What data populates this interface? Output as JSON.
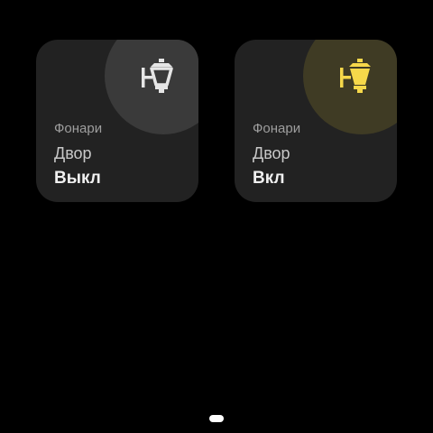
{
  "tiles": [
    {
      "category": "Фонари",
      "room": "Двор",
      "state": "Выкл",
      "icon": "street-lamp-icon",
      "icon_color": "#e6e6e6",
      "icon_bg_color": "#3a3a3a"
    },
    {
      "category": "Фонари",
      "room": "Двор",
      "state": "Вкл",
      "icon": "street-lamp-icon",
      "icon_color": "#f6d84a",
      "icon_bg_color": "#3f3b24"
    }
  ],
  "colors": {
    "background": "#000000",
    "tile": "#222222",
    "on_accent": "#f6d84a",
    "off_accent": "#e6e6e6"
  }
}
